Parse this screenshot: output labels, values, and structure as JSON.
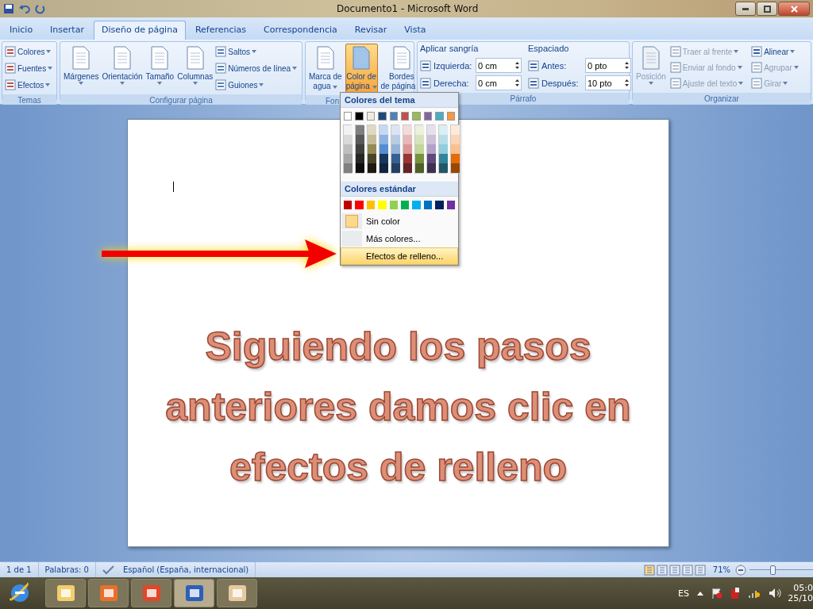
{
  "window": {
    "title": "Documento1 - Microsoft Word"
  },
  "tabs": [
    {
      "label": "Inicio",
      "selected": false
    },
    {
      "label": "Insertar",
      "selected": false
    },
    {
      "label": "Diseño de página",
      "selected": true
    },
    {
      "label": "Referencias",
      "selected": false
    },
    {
      "label": "Correspondencia",
      "selected": false
    },
    {
      "label": "Revisar",
      "selected": false
    },
    {
      "label": "Vista",
      "selected": false
    }
  ],
  "ribbon": {
    "temas": {
      "label": "Temas",
      "items": [
        {
          "label": "Colores"
        },
        {
          "label": "Fuentes"
        },
        {
          "label": "Efectos"
        }
      ]
    },
    "configurar": {
      "label": "Configurar página",
      "large": [
        {
          "label": "Márgenes"
        },
        {
          "label": "Orientación"
        },
        {
          "label": "Tamaño"
        },
        {
          "label": "Columnas"
        }
      ],
      "small": [
        {
          "label": "Saltos"
        },
        {
          "label": "Números de línea"
        },
        {
          "label": "Guiones"
        }
      ]
    },
    "fondo": {
      "label": "Fon",
      "buttons": [
        {
          "lines": [
            "Marca de",
            "agua"
          ],
          "selected": false
        },
        {
          "lines": [
            "Color de",
            "página"
          ],
          "selected": true
        },
        {
          "lines": [
            "Bordes",
            "de página"
          ],
          "selected": false
        }
      ]
    },
    "parrafo": {
      "label": "Párrafo",
      "sections": [
        {
          "title": "Aplicar sangría",
          "fields": [
            {
              "label": "Izquierda:",
              "value": "0 cm"
            },
            {
              "label": "Derecha:",
              "value": "0 cm"
            }
          ]
        },
        {
          "title": "Espaciado",
          "fields": [
            {
              "label": "Antes:",
              "value": "0 pto"
            },
            {
              "label": "Después:",
              "value": "10 pto"
            }
          ]
        }
      ]
    },
    "organizar": {
      "label": "Organizar",
      "posicion": {
        "label": "Posición",
        "disabled": true
      },
      "items": [
        {
          "label": "Traer al frente",
          "disabled": true
        },
        {
          "label": "Alinear",
          "disabled": false
        },
        {
          "label": "Enviar al fondo",
          "disabled": true
        },
        {
          "label": "Agrupar",
          "disabled": true
        },
        {
          "label": "Ajuste del texto",
          "disabled": true
        },
        {
          "label": "Girar",
          "disabled": true
        }
      ]
    }
  },
  "color_menu": {
    "theme_title": "Colores del tema",
    "theme_colors": [
      {
        "color": "#ffffff",
        "shades": [
          {
            "color": "#f2f2f2"
          },
          {
            "color": "#d9d9d9"
          },
          {
            "color": "#bfbfbf"
          },
          {
            "color": "#a6a6a6"
          },
          {
            "color": "#808080"
          }
        ]
      },
      {
        "color": "#000000",
        "shades": [
          {
            "color": "#7f7f7f"
          },
          {
            "color": "#595959"
          },
          {
            "color": "#3f3f3f"
          },
          {
            "color": "#262626"
          },
          {
            "color": "#0d0d0d"
          }
        ]
      },
      {
        "color": "#eeece1",
        "shades": [
          {
            "color": "#ddd9c3"
          },
          {
            "color": "#c4bd97"
          },
          {
            "color": "#948a54"
          },
          {
            "color": "#4a452a"
          },
          {
            "color": "#1d1b10"
          }
        ]
      },
      {
        "color": "#1f497d",
        "shades": [
          {
            "color": "#c6d9f0"
          },
          {
            "color": "#8db3e2"
          },
          {
            "color": "#548dd4"
          },
          {
            "color": "#17365d"
          },
          {
            "color": "#0f243e"
          }
        ]
      },
      {
        "color": "#4f81bd",
        "shades": [
          {
            "color": "#dbe5f1"
          },
          {
            "color": "#b8cce4"
          },
          {
            "color": "#95b3d7"
          },
          {
            "color": "#366092"
          },
          {
            "color": "#244061"
          }
        ]
      },
      {
        "color": "#c0504d",
        "shades": [
          {
            "color": "#f2dcdb"
          },
          {
            "color": "#e5b9b7"
          },
          {
            "color": "#d99694"
          },
          {
            "color": "#953734"
          },
          {
            "color": "#632423"
          }
        ]
      },
      {
        "color": "#9bbb59",
        "shades": [
          {
            "color": "#ebf1dd"
          },
          {
            "color": "#d7e3bc"
          },
          {
            "color": "#c3d69b"
          },
          {
            "color": "#76923c"
          },
          {
            "color": "#4f6128"
          }
        ]
      },
      {
        "color": "#8064a2",
        "shades": [
          {
            "color": "#e5e0ec"
          },
          {
            "color": "#ccc1d9"
          },
          {
            "color": "#b2a2c7"
          },
          {
            "color": "#5f497a"
          },
          {
            "color": "#3f3151"
          }
        ]
      },
      {
        "color": "#4bacc6",
        "shades": [
          {
            "color": "#dbeef3"
          },
          {
            "color": "#b7dde8"
          },
          {
            "color": "#92cddc"
          },
          {
            "color": "#31859b"
          },
          {
            "color": "#205867"
          }
        ]
      },
      {
        "color": "#f79646",
        "shades": [
          {
            "color": "#fdeada"
          },
          {
            "color": "#fbd5b5"
          },
          {
            "color": "#fac08f"
          },
          {
            "color": "#e36c09"
          },
          {
            "color": "#974806"
          }
        ]
      }
    ],
    "standard_title": "Colores estándar",
    "standard_colors": [
      {
        "color": "#c00000"
      },
      {
        "color": "#ff0000"
      },
      {
        "color": "#ffc000"
      },
      {
        "color": "#ffff00"
      },
      {
        "color": "#92d050"
      },
      {
        "color": "#00b050"
      },
      {
        "color": "#00b0f0"
      },
      {
        "color": "#0070c0"
      },
      {
        "color": "#002060"
      },
      {
        "color": "#7030a0"
      }
    ],
    "items": [
      {
        "label": "Sin color",
        "kind": "swatch",
        "selected": false
      },
      {
        "label": "Más colores...",
        "kind": "plain",
        "selected": false
      },
      {
        "label": "Efectos de relleno...",
        "kind": "plain",
        "selected": true
      }
    ]
  },
  "document": {
    "text": "Siguiendo los pasos anteriores damos clic en efectos de relleno"
  },
  "status_bar": {
    "items": [
      "1 de 1",
      "Palabras: 0",
      "Español (España, internacional)"
    ],
    "zoom": "71%",
    "zoom_level": {
      "level": 0.35
    }
  },
  "taskbar": {
    "language": "ES",
    "time": "05:0",
    "date": "25/10"
  }
}
